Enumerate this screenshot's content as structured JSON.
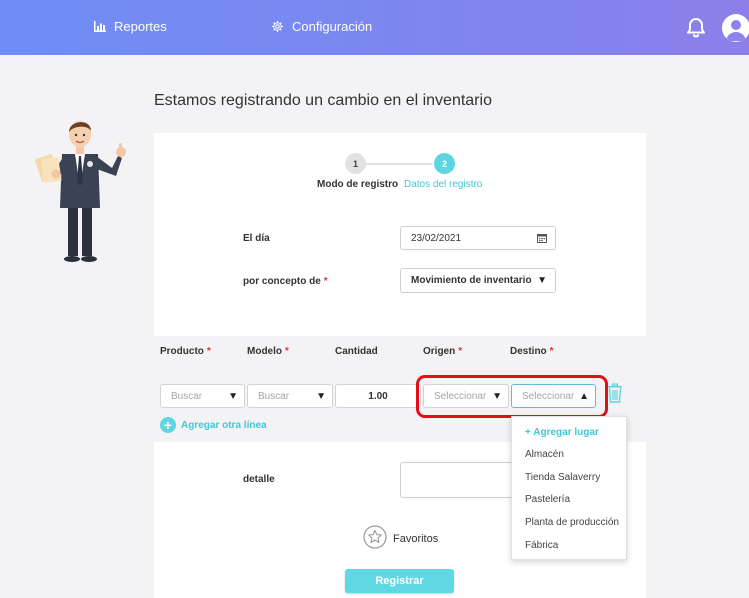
{
  "nav": {
    "reports_label": "Reportes",
    "config_label": "Configuración"
  },
  "page": {
    "title": "Estamos registrando un cambio en el inventario"
  },
  "steps": [
    {
      "number": "1",
      "label": "Modo de registro",
      "active": false
    },
    {
      "number": "2",
      "label": "Datos del registro",
      "active": true
    }
  ],
  "form": {
    "date_label": "El día",
    "date_value": "23/02/2021",
    "concept_label": "por concepto de",
    "concept_value": "Movimiento de inventario",
    "required_mark": "*"
  },
  "table": {
    "columns": [
      "Producto",
      "Modelo",
      "Cantidad",
      "Origen",
      "Destino"
    ],
    "row": {
      "product_placeholder": "Buscar",
      "model_placeholder": "Buscar",
      "quantity": "1.00",
      "origin_placeholder": "Seleccionar",
      "destination_placeholder": "Seleccionar"
    },
    "add_line_label": "Agregar otra línea"
  },
  "destination_dropdown": {
    "add_label": "+ Agregar lugar",
    "options": [
      "Almacén",
      "Tienda Salaverry",
      "Pastelería",
      "Planta de producción",
      "Fábrica"
    ]
  },
  "detail": {
    "label": "detalle"
  },
  "favorites_label": "Favoritos",
  "register_label": "Registrar",
  "colors": {
    "accent": "#5ed5e0",
    "highlight": "#e0101a",
    "required": "#e0342e"
  },
  "icons": [
    "bar-chart-icon",
    "gear-icon",
    "bell-icon",
    "user-avatar-icon",
    "calendar-icon",
    "chevron-down-icon",
    "chevron-up-icon",
    "trash-icon",
    "plus-circle-icon",
    "star-icon"
  ]
}
